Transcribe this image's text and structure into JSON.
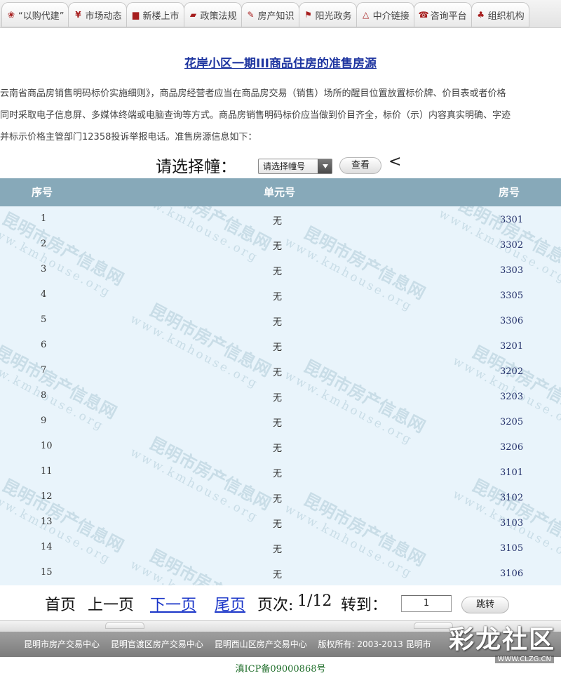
{
  "nav": {
    "tabs": [
      {
        "label": "“以购代建”",
        "icon": "leaf-icon",
        "glyph": "❀"
      },
      {
        "label": "市场动态",
        "icon": "yuan-icon",
        "glyph": "¥"
      },
      {
        "label": "新楼上市",
        "icon": "building-icon",
        "glyph": "▆"
      },
      {
        "label": "政策法规",
        "icon": "book-icon",
        "glyph": "▰"
      },
      {
        "label": "房产知识",
        "icon": "handshake-icon",
        "glyph": "✎"
      },
      {
        "label": "阳光政务",
        "icon": "flag-icon",
        "glyph": "⚑"
      },
      {
        "label": "中介链接",
        "icon": "triangle-icon",
        "glyph": "△"
      },
      {
        "label": "咨询平台",
        "icon": "phone-icon",
        "glyph": "☎"
      },
      {
        "label": "组织机构",
        "icon": "org-icon",
        "glyph": "♣"
      }
    ]
  },
  "page": {
    "title": "花岸小区一期III商品住房的准售房源",
    "intro": [
      "云南省商品房销售明码标价实施细则》，商品房经营者应当在商品房交易（销售）场所的醒目位置放置标价牌、价目表或者价格",
      "同时采取电子信息屏、多媒体终端或电脑查询等方式。商品房销售明码标价应当做到价目齐全，标价（示）内容真实明确、字迹",
      "并标示价格主管部门12358投诉举报电话。准售房源信息如下："
    ]
  },
  "selector": {
    "label": "请选择幢：",
    "select_value": "请选择幢号",
    "view_button": "查看",
    "back_symbol": "<"
  },
  "table": {
    "headers": {
      "seq": "序号",
      "unit": "单元号",
      "room": "房号"
    },
    "rows": [
      {
        "seq": "1",
        "unit": "无",
        "room": "3301"
      },
      {
        "seq": "2",
        "unit": "无",
        "room": "3302"
      },
      {
        "seq": "3",
        "unit": "无",
        "room": "3303"
      },
      {
        "seq": "4",
        "unit": "无",
        "room": "3305"
      },
      {
        "seq": "5",
        "unit": "无",
        "room": "3306"
      },
      {
        "seq": "6",
        "unit": "无",
        "room": "3201"
      },
      {
        "seq": "7",
        "unit": "无",
        "room": "3202"
      },
      {
        "seq": "8",
        "unit": "无",
        "room": "3203"
      },
      {
        "seq": "9",
        "unit": "无",
        "room": "3205"
      },
      {
        "seq": "10",
        "unit": "无",
        "room": "3206"
      },
      {
        "seq": "11",
        "unit": "无",
        "room": "3101"
      },
      {
        "seq": "12",
        "unit": "无",
        "room": "3102"
      },
      {
        "seq": "13",
        "unit": "无",
        "room": "3103"
      },
      {
        "seq": "14",
        "unit": "无",
        "room": "3105"
      },
      {
        "seq": "15",
        "unit": "无",
        "room": "3106"
      }
    ],
    "watermark": {
      "name": "昆明市房产信息网",
      "url": "www.kmhouse.org"
    }
  },
  "pager": {
    "first": "首页",
    "prev": "上一页",
    "next": "下一页",
    "last": "尾页",
    "page_label": "页次:",
    "page_value": "1/12",
    "goto_label": "转到：",
    "goto_input": "1",
    "jump_button": "跳转"
  },
  "footer": {
    "links": [
      "昆明市房产交易中心",
      "昆明官渡区房产交易中心",
      "昆明西山区房产交易中心",
      "版权所有: 2003-2013 昆明市"
    ],
    "icp": "滇ICP备09000868号"
  },
  "logo": {
    "text": "彩龙社区",
    "url": "WWW.CLZG.CN"
  }
}
